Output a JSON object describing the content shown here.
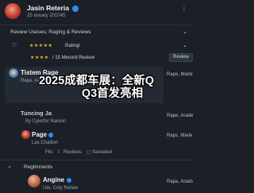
{
  "header": {
    "name": "Jasin Reteria",
    "date": "25 anuary 201045"
  },
  "section1": {
    "title": "Review Useses; Raging & Reviews"
  },
  "rating_row": {
    "stars": "★★★★★",
    "label": "Ratingl"
  },
  "review_row": {
    "stars": "★★★★",
    "label": "/ 15 Mecord Review",
    "button": "Review"
  },
  "cards": [
    {
      "name": "Tistem Rage",
      "line": "Rape, Araden",
      "right": "Rape, Marle"
    },
    {
      "title": "Tuncing Ja",
      "sub": "By Cylerfor Raision",
      "right": "Rape, Arade"
    }
  ],
  "page_entry": {
    "name": "Page",
    "sub": "Las Chaillon",
    "right": "Raps, Marle",
    "actions": [
      "Flls",
      "Reviews",
      "Savealed"
    ]
  },
  "section2": {
    "title": "Reglimnents"
  },
  "angine_entry": {
    "name": "Angine",
    "sub": "Ute, Coly Rellaw",
    "right": "Rapa, Arads"
  },
  "overlay": {
    "line1": "2025成都车展：全新Q",
    "line2": "Q3首发亮相"
  }
}
